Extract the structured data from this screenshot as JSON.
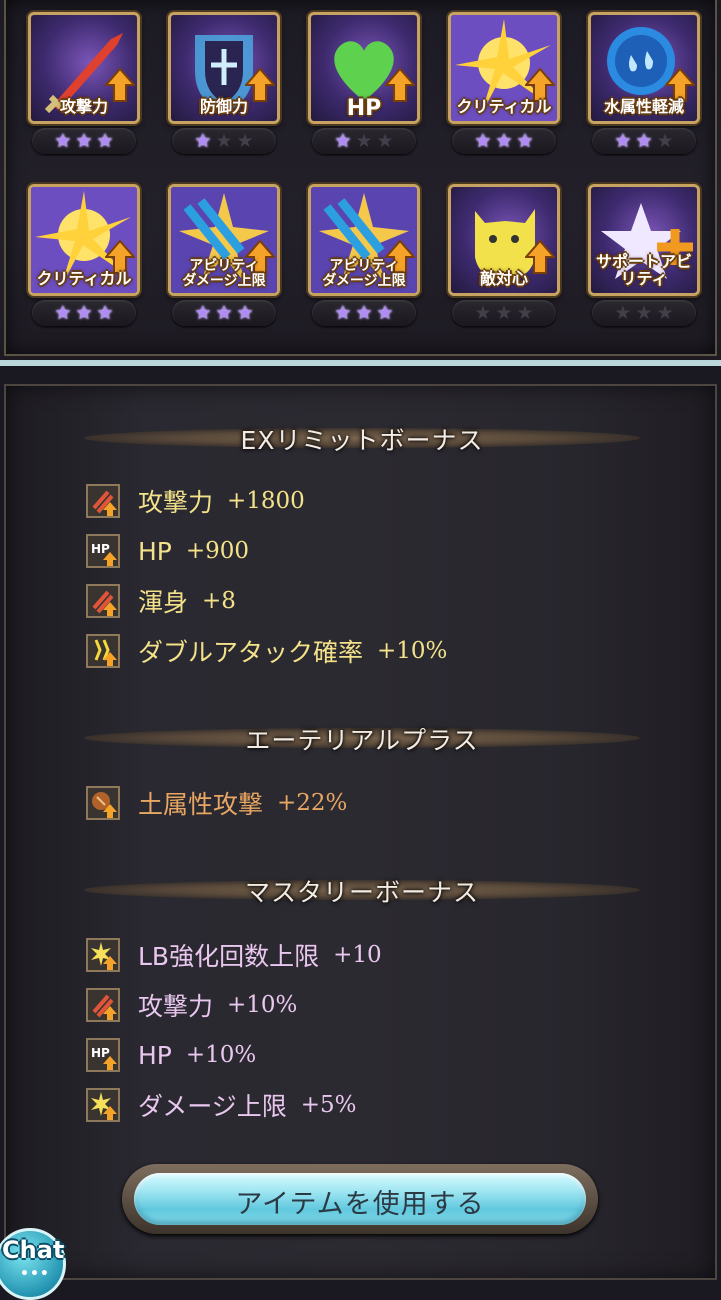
{
  "limit_bonus_grid": [
    {
      "label": "攻撃力",
      "stars": 3,
      "max": 3,
      "icon": "sword-icon",
      "style": ""
    },
    {
      "label": "防御力",
      "stars": 1,
      "max": 3,
      "icon": "shield-icon",
      "style": ""
    },
    {
      "label": "HP",
      "stars": 1,
      "max": 3,
      "icon": "heart-icon",
      "style": "big"
    },
    {
      "label": "クリティカル",
      "stars": 3,
      "max": 3,
      "icon": "lightning-burst-icon",
      "style": ""
    },
    {
      "label": "水属性軽減",
      "stars": 2,
      "max": 3,
      "icon": "water-drop-icon",
      "style": ""
    },
    {
      "label": "クリティカル",
      "stars": 3,
      "max": 3,
      "icon": "lightning-burst-icon",
      "style": ""
    },
    {
      "label": "アビリティ\nダメージ上限",
      "stars": 3,
      "max": 3,
      "icon": "crossed-blades-icon",
      "style": "two"
    },
    {
      "label": "アビリティ\nダメージ上限",
      "stars": 3,
      "max": 3,
      "icon": "crossed-blades-icon",
      "style": "two"
    },
    {
      "label": "敵対心",
      "stars": 0,
      "max": 3,
      "icon": "taunt-monster-icon",
      "style": ""
    },
    {
      "label": "サポートアビリティ",
      "stars": 0,
      "max": 3,
      "icon": "star-plus-icon",
      "style": ""
    }
  ],
  "sections": {
    "ex_limit": {
      "title": "EXリミットボーナス",
      "items": [
        {
          "name": "攻撃力",
          "value": "+1800",
          "icon": "attack-up-icon"
        },
        {
          "name": "HP",
          "value": "+900",
          "icon": "hp-up-icon"
        },
        {
          "name": "渾身",
          "value": "+8",
          "icon": "attack-up-icon"
        },
        {
          "name": "ダブルアタック確率",
          "value": "+10%",
          "icon": "double-attack-icon"
        }
      ]
    },
    "ethereal": {
      "title": "エーテリアルプラス",
      "items": [
        {
          "name": "土属性攻撃",
          "value": "+22%",
          "icon": "earth-attack-icon"
        }
      ]
    },
    "mastery": {
      "title": "マスタリーボーナス",
      "items": [
        {
          "name": "LB強化回数上限",
          "value": "+10",
          "icon": "burst-up-icon"
        },
        {
          "name": "攻撃力",
          "value": "+10%",
          "icon": "attack-up-icon"
        },
        {
          "name": "HP",
          "value": "+10%",
          "icon": "hp-up-icon"
        },
        {
          "name": "ダメージ上限",
          "value": "+5%",
          "icon": "burst-up-icon"
        }
      ]
    }
  },
  "use_item_button": "アイテムを使用する",
  "chat_button": "Chat",
  "colors": {
    "star_on": "#b08af5",
    "ex_text": "#f3e28a",
    "ethereal_text": "#e8a663",
    "mastery_text": "#e9c7ee",
    "button": "#61c8de"
  }
}
